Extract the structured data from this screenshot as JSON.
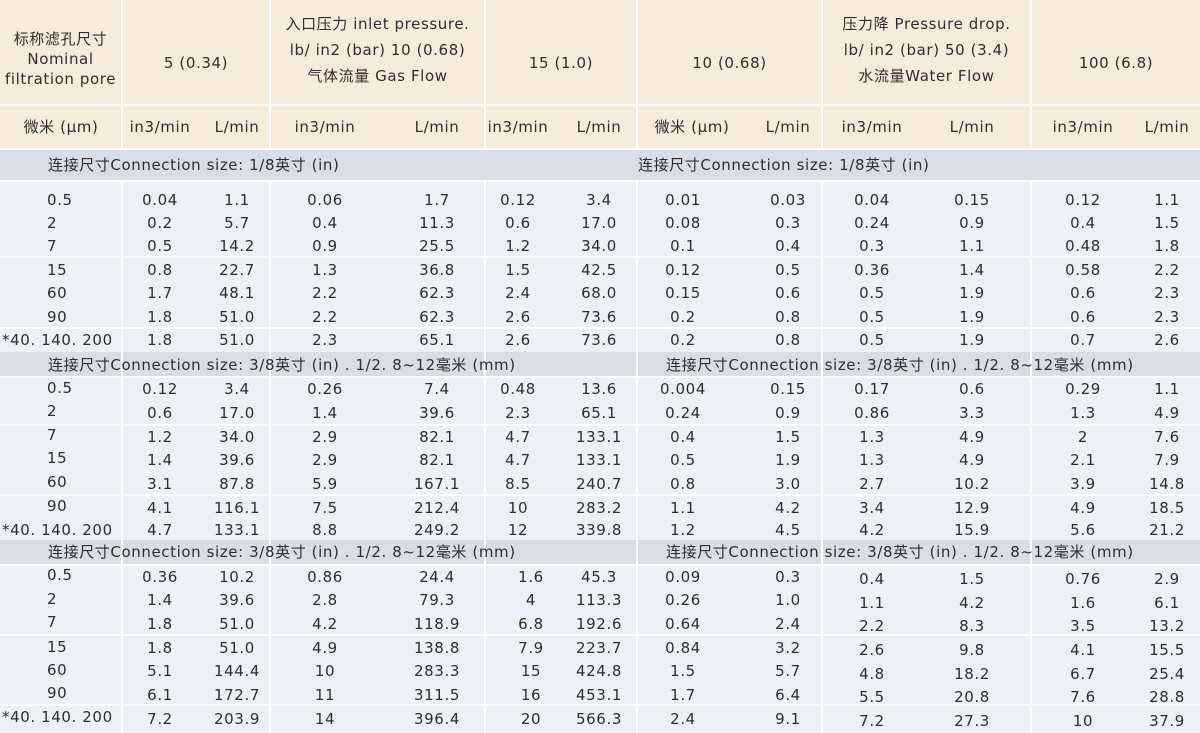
{
  "header": {
    "col0": [
      "标称滤孔尺寸",
      "Nominal",
      "filtration pore"
    ],
    "col1": [
      "5 (0.34)"
    ],
    "col2": [
      "入口压力 inlet pressure.",
      "lb/ in2 (bar) 10 (0.68)",
      "气体流量 Gas Flow"
    ],
    "col3": [
      "15 (1.0)"
    ],
    "col4": [
      "10 (0.68)"
    ],
    "col5": [
      "压力降 Pressure drop.",
      "lb/ in2 (bar) 50 (3.4)",
      "水流量Water Flow"
    ],
    "col6": [
      "100 (6.8)"
    ]
  },
  "units": {
    "micron": "微米 (μm)",
    "in3": "in3/min",
    "lmin": "L/min"
  },
  "sections": [
    {
      "title_left": "连接尺寸Connection size: 1/8英寸 (in)",
      "title_right": "连接尺寸Connection size: 1/8英寸 (in)",
      "rows": [
        [
          "0.5",
          "0.04",
          "1.1",
          "0.06",
          "1.7",
          "0.12",
          "3.4",
          "0.01",
          "0.03",
          "0.04",
          "0.15",
          "0.12",
          "1.1"
        ],
        [
          "2",
          "0.2",
          "5.7",
          "0.4",
          "11.3",
          "0.6",
          "17.0",
          "0.08",
          "0.3",
          "0.24",
          "0.9",
          "0.4",
          "1.5"
        ],
        [
          "7",
          "0.5",
          "14.2",
          "0.9",
          "25.5",
          "1.2",
          "34.0",
          "0.1",
          "0.4",
          "0.3",
          "1.1",
          "0.48",
          "1.8"
        ],
        [
          "15",
          "0.8",
          "22.7",
          "1.3",
          "36.8",
          "1.5",
          "42.5",
          "0.12",
          "0.5",
          "0.36",
          "1.4",
          "0.58",
          "2.2"
        ],
        [
          "60",
          "1.7",
          "48.1",
          "2.2",
          "62.3",
          "2.4",
          "68.0",
          "0.15",
          "0.6",
          "0.5",
          "1.9",
          "0.6",
          "2.3"
        ],
        [
          "90",
          "1.8",
          "51.0",
          "2.2",
          "62.3",
          "2.6",
          "73.6",
          "0.2",
          "0.8",
          "0.5",
          "1.9",
          "0.6",
          "2.3"
        ],
        [
          "*40. 140. 200",
          "1.8",
          "51.0",
          "2.3",
          "65.1",
          "2.6",
          "73.6",
          "0.2",
          "0.8",
          "0.5",
          "1.9",
          "0.7",
          "2.6"
        ]
      ]
    },
    {
      "title_left": "连接尺寸Connection size: 3/8英寸 (in) . 1/2. 8~12毫米 (mm)",
      "title_right": "连接尺寸Connection size: 3/8英寸 (in) . 1/2. 8~12毫米 (mm)",
      "rows": [
        [
          "0.5",
          "0.12",
          "3.4",
          "0.26",
          "7.4",
          "0.48",
          "13.6",
          "0.004",
          "0.15",
          "0.17",
          "0.6",
          "0.29",
          "1.1"
        ],
        [
          "2",
          "0.6",
          "17.0",
          "1.4",
          "39.6",
          "2.3",
          "65.1",
          "0.24",
          "0.9",
          "0.86",
          "3.3",
          "1.3",
          "4.9"
        ],
        [
          "7",
          "1.2",
          "34.0",
          "2.9",
          "82.1",
          "4.7",
          "133.1",
          "0.4",
          "1.5",
          "1.3",
          "4.9",
          "2",
          "7.6"
        ],
        [
          "15",
          "1.4",
          "39.6",
          "2.9",
          "82.1",
          "4.7",
          "133.1",
          "0.5",
          "1.9",
          "1.3",
          "4.9",
          "2.1",
          "7.9"
        ],
        [
          "60",
          "3.1",
          "87.8",
          "5.9",
          "167.1",
          "8.5",
          "240.7",
          "0.8",
          "3.0",
          "2.7",
          "10.2",
          "3.9",
          "14.8"
        ],
        [
          "90",
          "4.1",
          "116.1",
          "7.5",
          "212.4",
          "10",
          "283.2",
          "1.1",
          "4.2",
          "3.4",
          "12.9",
          "4.9",
          "18.5"
        ],
        [
          "*40. 140. 200",
          "4.7",
          "133.1",
          "8.8",
          "249.2",
          "12",
          "339.8",
          "1.2",
          "4.5",
          "4.2",
          "15.9",
          "5.6",
          "21.2"
        ]
      ]
    },
    {
      "title_left": "连接尺寸Connection size: 3/8英寸 (in) . 1/2. 8~12毫米 (mm)",
      "title_right": "连接尺寸Connection size: 3/8英寸 (in) . 1/2. 8~12毫米 (mm)",
      "rows": [
        [
          "0.5",
          "0.36",
          "10.2",
          "0.86",
          "24.4",
          "1.6",
          "45.3",
          "0.09",
          "0.3",
          "0.4",
          "1.5",
          "0.76",
          "2.9"
        ],
        [
          "2",
          "1.4",
          "39.6",
          "2.8",
          "79.3",
          "4",
          "113.3",
          "0.26",
          "1.0",
          "1.1",
          "4.2",
          "1.6",
          "6.1"
        ],
        [
          "7",
          "1.8",
          "51.0",
          "4.2",
          "118.9",
          "6.8",
          "192.6",
          "0.64",
          "2.4",
          "2.2",
          "8.3",
          "3.5",
          "13.2"
        ],
        [
          "15",
          "1.8",
          "51.0",
          "4.9",
          "138.8",
          "7.9",
          "223.7",
          "0.84",
          "3.2",
          "2.6",
          "9.8",
          "4.1",
          "15.5"
        ],
        [
          "60",
          "5.1",
          "144.4",
          "10",
          "283.3",
          "15",
          "424.8",
          "1.5",
          "5.7",
          "4.8",
          "18.2",
          "6.7",
          "25.4"
        ],
        [
          "90",
          "6.1",
          "172.7",
          "11",
          "311.5",
          "16",
          "453.1",
          "1.7",
          "6.4",
          "5.5",
          "20.8",
          "7.6",
          "28.8"
        ],
        [
          "*40. 140. 200",
          "7.2",
          "203.9",
          "14",
          "396.4",
          "20",
          "566.3",
          "2.4",
          "9.1",
          "7.2",
          "27.3",
          "10",
          "37.9"
        ]
      ]
    }
  ]
}
